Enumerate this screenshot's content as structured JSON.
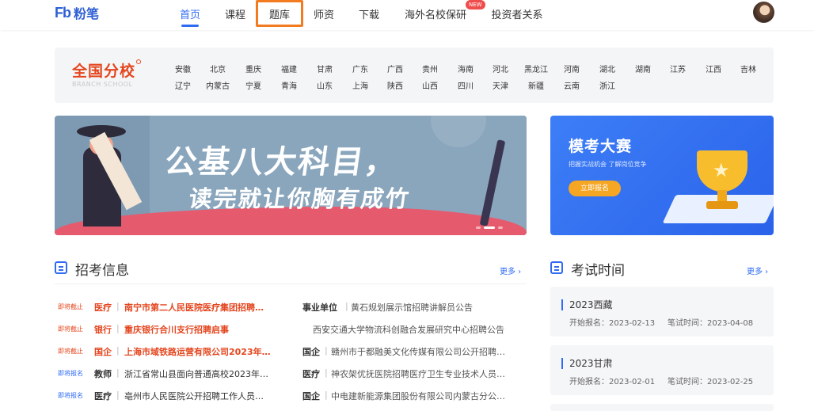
{
  "header": {
    "logo_mark": "Fb",
    "logo_text": "粉笔",
    "nav": [
      {
        "label": "首页",
        "active": true
      },
      {
        "label": "课程"
      },
      {
        "label": "题库",
        "highlighted": true
      },
      {
        "label": "师资"
      },
      {
        "label": "下载"
      },
      {
        "label": "海外名校保研",
        "badge": "NEW"
      },
      {
        "label": "投资者关系"
      }
    ]
  },
  "branch": {
    "title": "全国分校",
    "subtitle": "BRANCH SCHOOL",
    "row1": [
      "安徽",
      "北京",
      "重庆",
      "福建",
      "甘肃",
      "广东",
      "广西",
      "贵州",
      "海南",
      "河北",
      "黑龙江",
      "河南",
      "湖北",
      "湖南",
      "江苏",
      "江西",
      "吉林"
    ],
    "row2": [
      "辽宁",
      "内蒙古",
      "宁夏",
      "青海",
      "山东",
      "上海",
      "陕西",
      "山西",
      "四川",
      "天津",
      "新疆",
      "云南",
      "浙江"
    ]
  },
  "banner": {
    "line1": "公基八大科目，",
    "line2": "读完就让你胸有成竹"
  },
  "mock_exam": {
    "title": "模考大赛",
    "subtitle": "把握实战机会  了解岗位竞争",
    "button": "立即报名"
  },
  "recruit": {
    "title": "招考信息",
    "more": "更多 ›",
    "left": [
      {
        "tag": "即将截止",
        "category": "医疗",
        "title": "南宁市第二人民医院医疗集团招聘…",
        "urgent": true
      },
      {
        "tag": "即将截止",
        "category": "银行",
        "title": "重庆银行合川支行招聘启事",
        "urgent": true
      },
      {
        "tag": "即将截止",
        "category": "国企",
        "title": "上海市域铁路运营有限公司2023年…",
        "urgent": true
      },
      {
        "tag": "即将报名",
        "category": "教师",
        "title": "浙江省常山县面向普通高校2023年…",
        "urgent": false
      },
      {
        "tag": "即将报名",
        "category": "医疗",
        "title": "亳州市人民医院公开招聘工作人员…",
        "urgent": false
      }
    ],
    "right": [
      {
        "category": "事业单位",
        "title": "黄石规划展示馆招聘讲解员公告"
      },
      {
        "category": "",
        "title": "西安交通大学物流科创融合发展研究中心招聘公告"
      },
      {
        "category": "国企",
        "title": "赣州市于都融美文化传媒有限公司公开招聘…"
      },
      {
        "category": "医疗",
        "title": "神农架优抚医院招聘医疗卫生专业技术人员…"
      },
      {
        "category": "国企",
        "title": "中电建新能源集团股份有限公司内蒙古分公…"
      }
    ]
  },
  "exams": {
    "title": "考试时间",
    "more": "更多 ›",
    "items": [
      {
        "name": "2023西藏",
        "signup": "开始报名：2023-02-13",
        "written": "笔试时间：2023-04-08"
      },
      {
        "name": "2023甘肃",
        "signup": "开始报名：2023-02-01",
        "written": "笔试时间：2023-02-25"
      }
    ]
  },
  "colors": {
    "accent": "#2f6bf3",
    "urgent": "#e4461e",
    "highlight": "#f27b20"
  }
}
